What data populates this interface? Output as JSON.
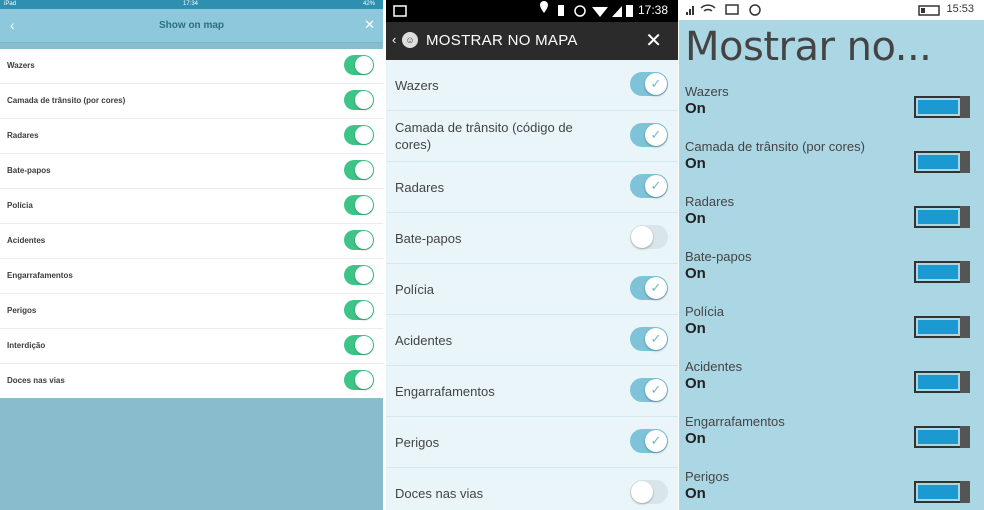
{
  "ios": {
    "status": {
      "carrier": "iPad",
      "time": "17:34",
      "battery": "42%"
    },
    "title": "Show on map",
    "back_icon": "chevron-left-icon",
    "close_icon": "close-icon",
    "items": [
      {
        "label": "Wazers",
        "on": true
      },
      {
        "label": "Camada de trânsito (por cores)",
        "on": true
      },
      {
        "label": "Radares",
        "on": true
      },
      {
        "label": "Bate-papos",
        "on": true
      },
      {
        "label": "Polícia",
        "on": true
      },
      {
        "label": "Acidentes",
        "on": true
      },
      {
        "label": "Engarrafamentos",
        "on": true
      },
      {
        "label": "Perigos",
        "on": true
      },
      {
        "label": "Interdição",
        "on": true
      },
      {
        "label": "Doces nas vias",
        "on": true
      }
    ],
    "switch_color": "#3ec487"
  },
  "android": {
    "status": {
      "time": "17:38"
    },
    "title": "MOSTRAR NO MAPA",
    "items": [
      {
        "label": "Wazers",
        "on": true
      },
      {
        "label": "Camada de trânsito (código de cores)",
        "on": true
      },
      {
        "label": "Radares",
        "on": true
      },
      {
        "label": "Bate-papos",
        "on": false
      },
      {
        "label": "Polícia",
        "on": true
      },
      {
        "label": "Acidentes",
        "on": true
      },
      {
        "label": "Engarrafamentos",
        "on": true
      },
      {
        "label": "Perigos",
        "on": true
      },
      {
        "label": "Doces nas vias",
        "on": false
      }
    ],
    "switch_color": "#7ec3d8"
  },
  "wp": {
    "status": {
      "time": "15:53"
    },
    "title": "Mostrar no...",
    "items": [
      {
        "label": "Wazers",
        "state": "On"
      },
      {
        "label": "Camada de trânsito (por cores)",
        "state": "On"
      },
      {
        "label": "Radares",
        "state": "On"
      },
      {
        "label": "Bate-papos",
        "state": "On"
      },
      {
        "label": "Polícia",
        "state": "On"
      },
      {
        "label": "Acidentes",
        "state": "On"
      },
      {
        "label": "Engarrafamentos",
        "state": "On"
      },
      {
        "label": "Perigos",
        "state": "On"
      }
    ],
    "switch_color": "#1b9ad2"
  }
}
